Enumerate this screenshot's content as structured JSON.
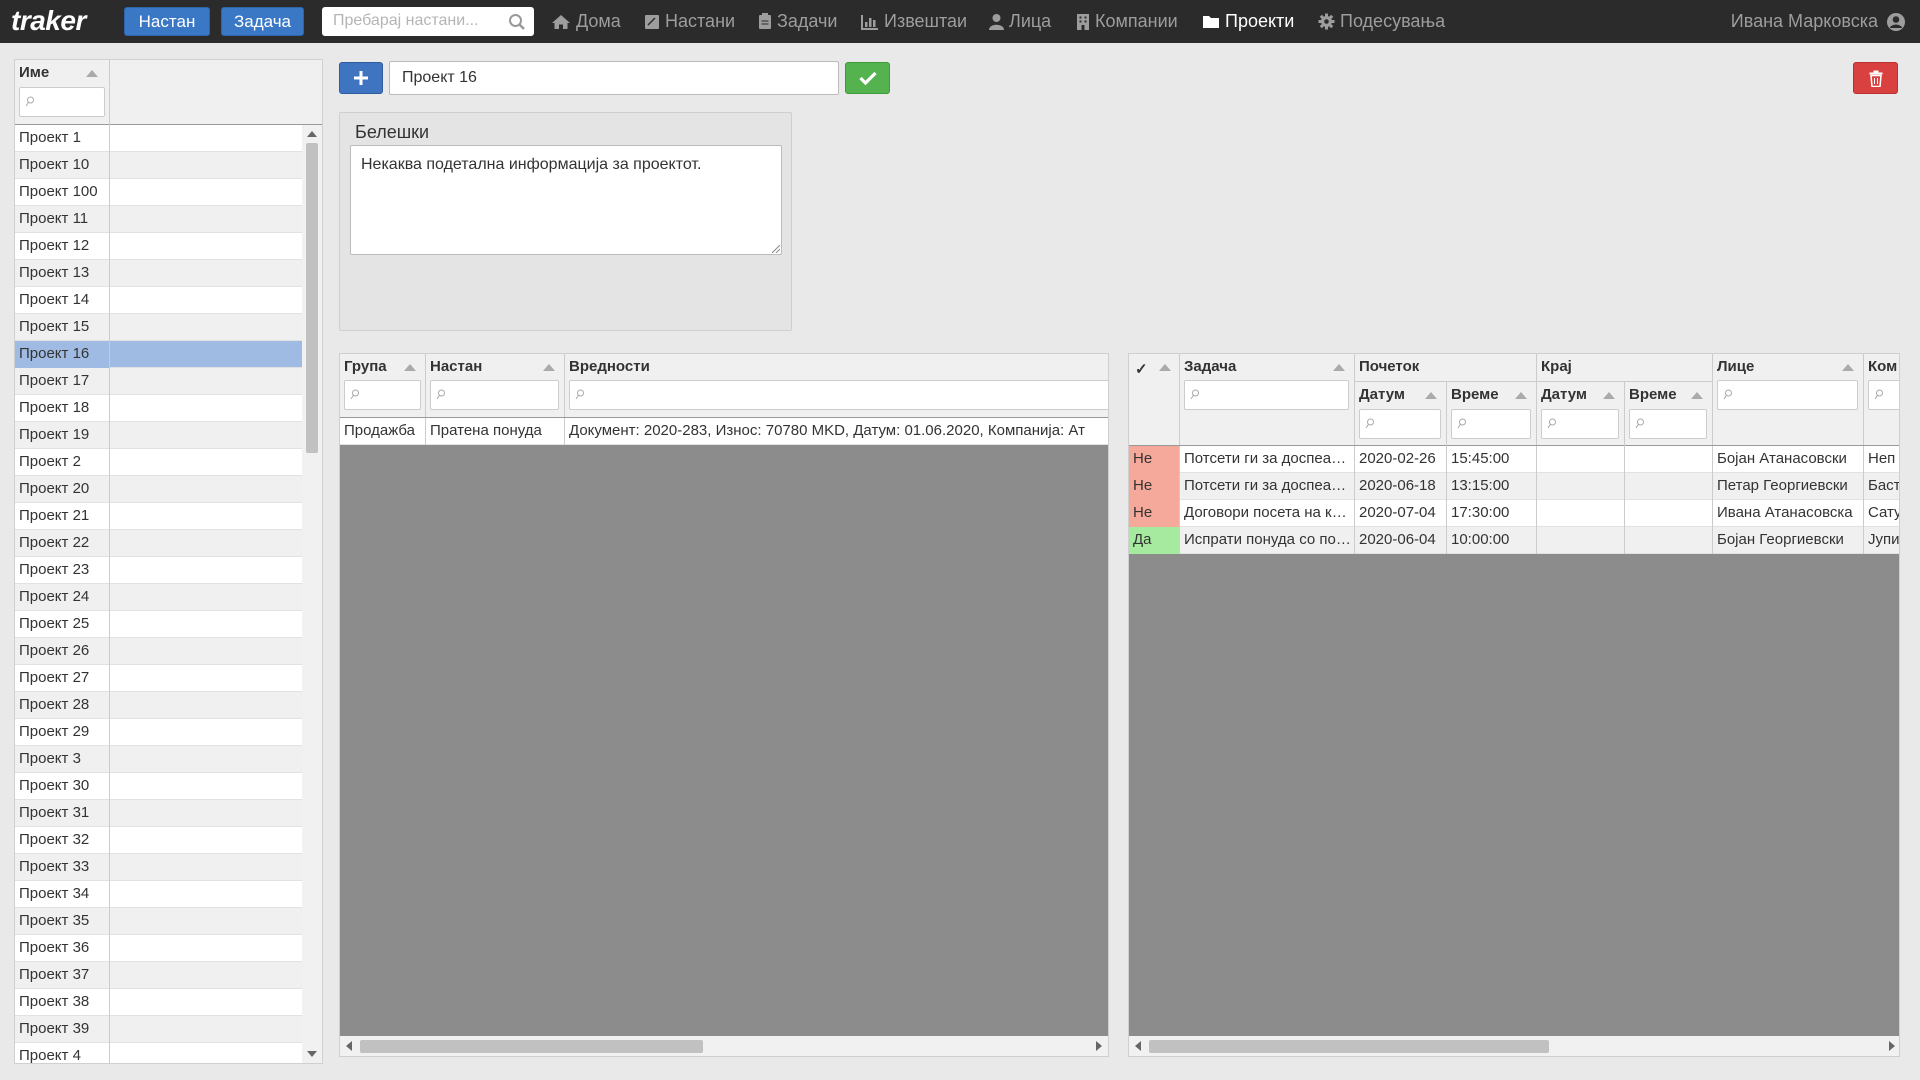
{
  "navbar": {
    "brand": "traker",
    "btn_event": "Настан",
    "btn_task": "Задача",
    "search_placeholder": "Пребарај настани...",
    "nav": [
      {
        "label": "Дома",
        "icon": "home-icon"
      },
      {
        "label": "Настани",
        "icon": "events-icon"
      },
      {
        "label": "Задачи",
        "icon": "tasks-icon"
      },
      {
        "label": "Извештаи",
        "icon": "reports-icon"
      },
      {
        "label": "Лица",
        "icon": "person-icon"
      },
      {
        "label": "Компании",
        "icon": "building-icon"
      },
      {
        "label": "Проекти",
        "icon": "folder-icon",
        "active": true
      },
      {
        "label": "Подесувања",
        "icon": "gear-icon"
      }
    ],
    "user": "Ивана Марковска"
  },
  "project_list": {
    "header": "Име",
    "items": [
      "Проект 1",
      "Проект 10",
      "Проект 100",
      "Проект 11",
      "Проект 12",
      "Проект 13",
      "Проект 14",
      "Проект 15",
      "Проект 16",
      "Проект 17",
      "Проект 18",
      "Проект 19",
      "Проект 2",
      "Проект 20",
      "Проект 21",
      "Проект 22",
      "Проект 23",
      "Проект 24",
      "Проект 25",
      "Проект 26",
      "Проект 27",
      "Проект 28",
      "Проект 29",
      "Проект 3",
      "Проект 30",
      "Проект 31",
      "Проект 32",
      "Проект 33",
      "Проект 34",
      "Проект 35",
      "Проект 36",
      "Проект 37",
      "Проект 38",
      "Проект 39",
      "Проект 4"
    ],
    "selected": "Проект 16"
  },
  "editor": {
    "project_name": "Проект 16",
    "notes_title": "Белешки",
    "notes_text": "Некаква подетална информација за проектот."
  },
  "events_grid": {
    "headers": {
      "group": "Група",
      "event": "Настан",
      "values": "Вредности"
    },
    "rows": [
      {
        "group": "Продажба",
        "event": "Пратена понуда",
        "values": "Документ: 2020-283, Износ: 70780 MKD, Датум: 01.06.2020, Компанија: Ат"
      }
    ]
  },
  "tasks_grid": {
    "headers": {
      "check": "✓",
      "task": "Задача",
      "start": "Почеток",
      "end": "Крај",
      "date": "Датум",
      "time": "Време",
      "person": "Лице",
      "company": "Ком"
    },
    "rows": [
      {
        "done": "Не",
        "task": "Потсети ги за доспеани фактури",
        "start_date": "2020-02-26",
        "start_time": "15:45:00",
        "end_date": "",
        "end_time": "",
        "person": "Бојан Атанасовски",
        "company": "Неп"
      },
      {
        "done": "Не",
        "task": "Потсети ги за доспеани фактури",
        "start_date": "2020-06-18",
        "start_time": "13:15:00",
        "end_date": "",
        "end_time": "",
        "person": "Петар Георгиевски",
        "company": "Баст"
      },
      {
        "done": "Не",
        "task": "Договори посета на клиент",
        "start_date": "2020-07-04",
        "start_time": "17:30:00",
        "end_date": "",
        "end_time": "",
        "person": "Ивана Атанасовска",
        "company": "Сату"
      },
      {
        "done": "Да",
        "task": "Испрати понуда со попуст",
        "start_date": "2020-06-04",
        "start_time": "10:00:00",
        "end_date": "",
        "end_time": "",
        "person": "Бојан Георгиевски",
        "company": "Јупи"
      }
    ]
  }
}
